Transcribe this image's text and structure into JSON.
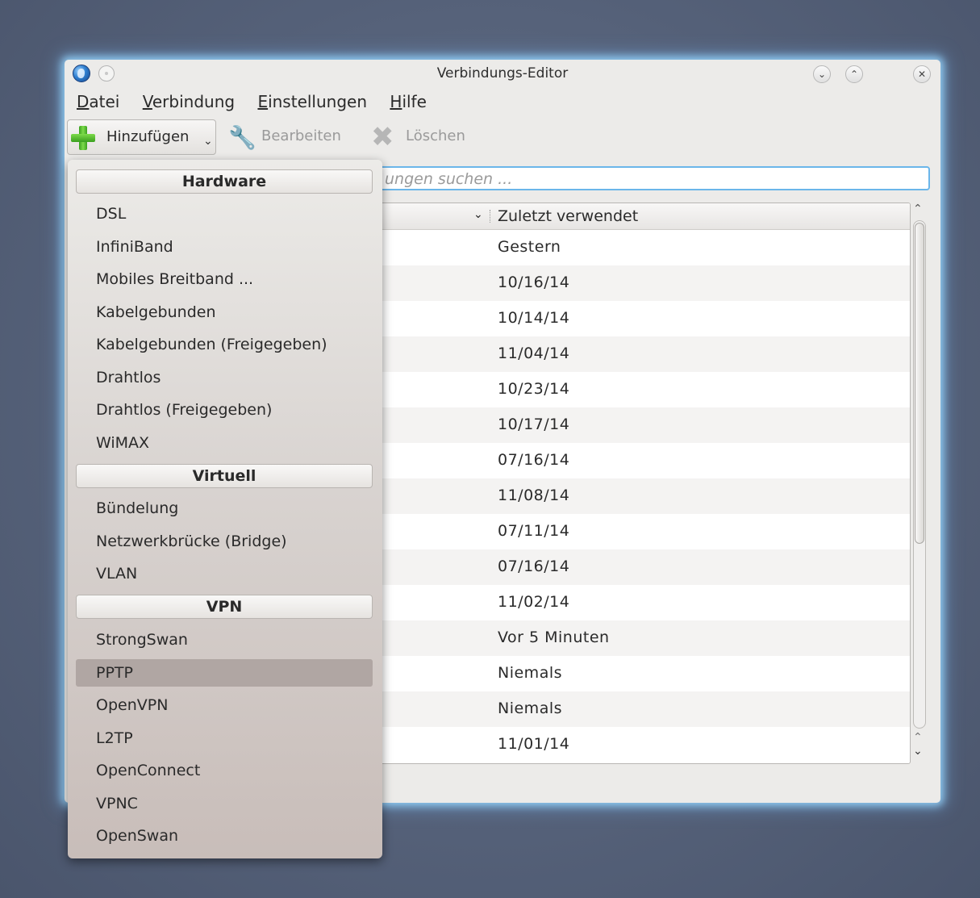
{
  "window": {
    "title": "Verbindungs-Editor",
    "menubar": [
      "Datei",
      "Verbindung",
      "Einstellungen",
      "Hilfe"
    ]
  },
  "toolbar": {
    "add_label": "Hinzufügen",
    "edit_label": "Bearbeiten",
    "delete_label": "Löschen"
  },
  "search": {
    "visible_text": "ungen suchen ..."
  },
  "table": {
    "column_header": "Zuletzt verwendet",
    "rows": [
      "Gestern",
      "10/16/14",
      "10/14/14",
      "11/04/14",
      "10/23/14",
      "10/17/14",
      "07/16/14",
      "11/08/14",
      "07/11/14",
      "07/16/14",
      "11/02/14",
      "Vor 5 Minuten",
      "Niemals",
      "Niemals",
      "11/01/14"
    ]
  },
  "dropdown": {
    "sections": [
      {
        "title": "Hardware",
        "items": [
          "DSL",
          "InfiniBand",
          "Mobiles Breitband ...",
          "Kabelgebunden",
          "Kabelgebunden (Freigegeben)",
          "Drahtlos",
          "Drahtlos (Freigegeben)",
          "WiMAX"
        ]
      },
      {
        "title": "Virtuell",
        "items": [
          "Bündelung",
          "Netzwerkbrücke (Bridge)",
          "VLAN"
        ]
      },
      {
        "title": "VPN",
        "items": [
          "StrongSwan",
          "PPTP",
          "OpenVPN",
          "L2TP",
          "OpenConnect",
          "VPNC",
          "OpenSwan"
        ]
      }
    ],
    "highlighted_item": "PPTP"
  },
  "icons": {
    "app": "globe-icon",
    "sticky": "pin-icon",
    "add": "plus-icon",
    "edit": "wrench-icon",
    "delete": "x-icon"
  }
}
